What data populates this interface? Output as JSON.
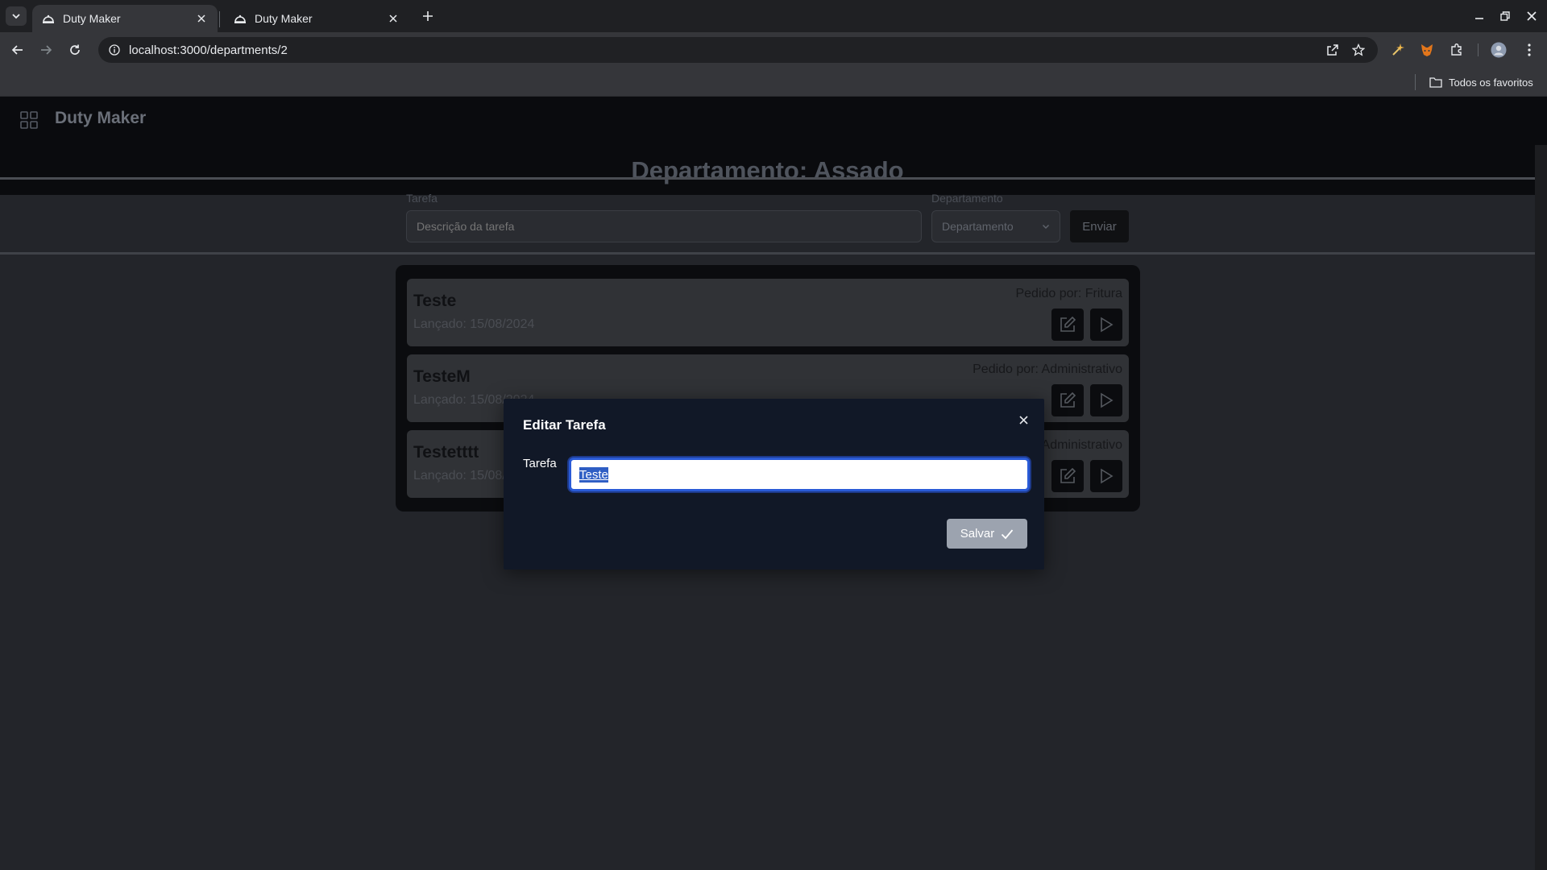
{
  "browser": {
    "tabs": [
      {
        "title": "Duty Maker",
        "active": true
      },
      {
        "title": "Duty Maker",
        "active": false
      }
    ],
    "url": "localhost:3000/departments/2",
    "bookmarks_all": "Todos os favoritos"
  },
  "app": {
    "title": "Duty Maker",
    "department_heading": "Departamento: Assado",
    "form": {
      "task_label": "Tarefa",
      "task_placeholder": "Descrição da tarefa",
      "department_label": "Departamento",
      "department_select": "Departamento",
      "send_label": "Enviar"
    },
    "tasks": [
      {
        "name": "Teste",
        "date": "Lançado: 15/08/2024",
        "requested_by": "Pedido por: Fritura"
      },
      {
        "name": "TesteM",
        "date": "Lançado: 15/08/2024",
        "requested_by": "Pedido por: Administrativo"
      },
      {
        "name": "Testetttt",
        "date": "Lançado: 15/08/2024",
        "requested_by": "Pedido por: Administrativo"
      }
    ]
  },
  "modal": {
    "title": "Editar Tarefa",
    "field_label": "Tarefa",
    "field_value": "Teste",
    "save_label": "Salvar"
  },
  "colors": {
    "modal_bg": "#111827",
    "save_button": "#9ca3af",
    "focus_ring": "#2a5bd7",
    "header_bg": "#0a0b0e"
  }
}
